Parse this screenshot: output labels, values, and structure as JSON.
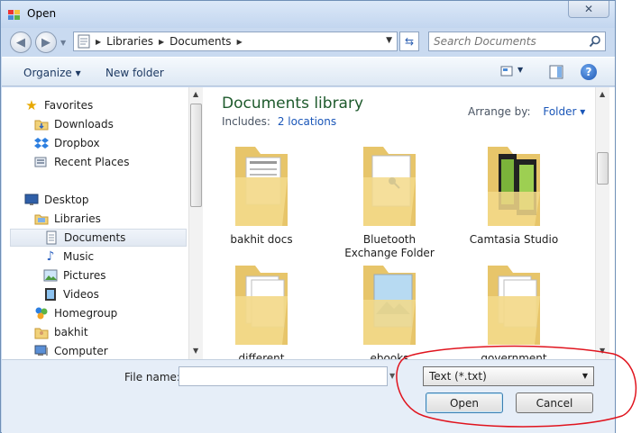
{
  "window": {
    "title": "Open",
    "close_label": "✕"
  },
  "address": {
    "crumbs": [
      "Libraries",
      "Documents"
    ]
  },
  "search": {
    "placeholder": "Search Documents"
  },
  "toolbar": {
    "organize_label": "Organize ▾",
    "new_folder_label": "New folder",
    "help_label": "?"
  },
  "nav": {
    "items": [
      {
        "label": "Favorites",
        "icon": "star-icon"
      },
      {
        "label": "Downloads",
        "icon": "downloads-folder-icon"
      },
      {
        "label": "Dropbox",
        "icon": "dropbox-icon"
      },
      {
        "label": "Recent Places",
        "icon": "recent-places-icon"
      },
      {
        "label": "Desktop",
        "icon": "desktop-icon"
      },
      {
        "label": "Libraries",
        "icon": "libraries-icon"
      },
      {
        "label": "Documents",
        "icon": "documents-icon"
      },
      {
        "label": "Music",
        "icon": "music-icon"
      },
      {
        "label": "Pictures",
        "icon": "pictures-icon"
      },
      {
        "label": "Videos",
        "icon": "videos-icon"
      },
      {
        "label": "Homegroup",
        "icon": "homegroup-icon"
      },
      {
        "label": "bakhit",
        "icon": "user-folder-icon"
      },
      {
        "label": "Computer",
        "icon": "computer-icon"
      }
    ],
    "selected": "Documents"
  },
  "library": {
    "title": "Documents library",
    "includes_label": "Includes:",
    "locations_link": "2 locations",
    "arrange_label": "Arrange by:",
    "arrange_value": "Folder ▾"
  },
  "folders": [
    {
      "line1": "bakhit docs",
      "line2": "",
      "icon": "folder-documents-icon"
    },
    {
      "line1": "Bluetooth",
      "line2": "Exchange Folder",
      "icon": "folder-bluetooth-icon"
    },
    {
      "line1": "Camtasia Studio",
      "line2": "",
      "icon": "folder-video-icon"
    },
    {
      "line1": "different",
      "line2": "",
      "icon": "folder-documents-icon"
    },
    {
      "line1": "ebooks",
      "line2": "",
      "icon": "folder-pictures-icon"
    },
    {
      "line1": "government",
      "line2": "",
      "icon": "folder-documents-icon"
    }
  ],
  "footer": {
    "file_name_label": "File name:",
    "file_name_value": "",
    "file_type_value": "Text (*.txt)",
    "open_label": "Open",
    "cancel_label": "Cancel"
  },
  "colors": {
    "annotation": "#e0141e",
    "title_green": "#1e5a2c",
    "link_blue": "#1a56b8"
  }
}
